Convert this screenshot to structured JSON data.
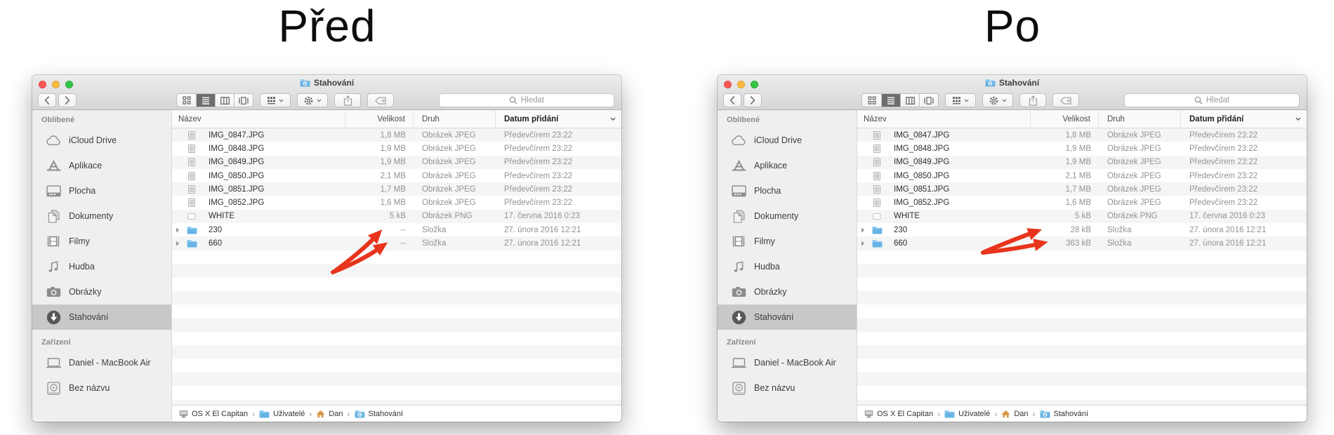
{
  "headings": {
    "left": "Před",
    "right": "Po"
  },
  "colors": {
    "arrow_red": "#e8341c",
    "folder_blue": "#68b3e5",
    "sidebar_selected_bg": "#c8c8c8",
    "traffic_red": "#fc5753",
    "traffic_yellow": "#fdbc40",
    "traffic_green": "#33c748"
  },
  "windows": {
    "left": {
      "title": "Stahování",
      "search_placeholder": "Hledat",
      "sidebar": {
        "sections": [
          {
            "label": "Oblíbené",
            "items": [
              {
                "icon": "cloud",
                "label": "iCloud Drive",
                "selected": false
              },
              {
                "icon": "apps",
                "label": "Aplikace",
                "selected": false
              },
              {
                "icon": "desktop",
                "label": "Plocha",
                "selected": false
              },
              {
                "icon": "docs",
                "label": "Dokumenty",
                "selected": false
              },
              {
                "icon": "film",
                "label": "Filmy",
                "selected": false
              },
              {
                "icon": "music",
                "label": "Hudba",
                "selected": false
              },
              {
                "icon": "camera",
                "label": "Obrázky",
                "selected": false
              },
              {
                "icon": "download",
                "label": "Stahování",
                "selected": true
              }
            ]
          },
          {
            "label": "Zařízení",
            "items": [
              {
                "icon": "laptop",
                "label": "Daniel - MacBook Air",
                "selected": false
              },
              {
                "icon": "disk",
                "label": "Bez názvu",
                "selected": false
              }
            ]
          }
        ]
      },
      "columns": {
        "name": "Název",
        "size": "Velikost",
        "kind": "Druh",
        "date": "Datum přidání"
      },
      "files": [
        {
          "icon": "jpeg",
          "name": "IMG_0847.JPG",
          "size": "1,8 MB",
          "kind": "Obrázek JPEG",
          "date": "Předevčírem 23:22"
        },
        {
          "icon": "jpeg",
          "name": "IMG_0848.JPG",
          "size": "1,9 MB",
          "kind": "Obrázek JPEG",
          "date": "Předevčírem 23:22"
        },
        {
          "icon": "jpeg",
          "name": "IMG_0849.JPG",
          "size": "1,9 MB",
          "kind": "Obrázek JPEG",
          "date": "Předevčírem 23:22"
        },
        {
          "icon": "jpeg",
          "name": "IMG_0850.JPG",
          "size": "2,1 MB",
          "kind": "Obrázek JPEG",
          "date": "Předevčírem 23:22"
        },
        {
          "icon": "jpeg",
          "name": "IMG_0851.JPG",
          "size": "1,7 MB",
          "kind": "Obrázek JPEG",
          "date": "Předevčírem 23:22"
        },
        {
          "icon": "jpeg",
          "name": "IMG_0852.JPG",
          "size": "1,6 MB",
          "kind": "Obrázek JPEG",
          "date": "Předevčírem 23:22"
        },
        {
          "icon": "png",
          "name": "WHITE",
          "size": "5 kB",
          "kind": "Obrázek PNG",
          "date": "17. června 2016 0:23"
        },
        {
          "icon": "folder",
          "name": "230",
          "size": "--",
          "kind": "Složka",
          "date": "27. února 2016 12:21"
        },
        {
          "icon": "folder",
          "name": "660",
          "size": "--",
          "kind": "Složka",
          "date": "27. února 2016 12:21"
        }
      ],
      "pathbar": [
        {
          "icon": "computer",
          "label": "OS X El Capitan"
        },
        {
          "icon": "folder",
          "label": "Uživatelé"
        },
        {
          "icon": "home",
          "label": "Dan"
        },
        {
          "icon": "folder-dl",
          "label": "Stahování"
        }
      ]
    },
    "right": {
      "title": "Stahování",
      "search_placeholder": "Hledat",
      "sidebar": {
        "sections": [
          {
            "label": "Oblíbené",
            "items": [
              {
                "icon": "cloud",
                "label": "iCloud Drive",
                "selected": false
              },
              {
                "icon": "apps",
                "label": "Aplikace",
                "selected": false
              },
              {
                "icon": "desktop",
                "label": "Plocha",
                "selected": false
              },
              {
                "icon": "docs",
                "label": "Dokumenty",
                "selected": false
              },
              {
                "icon": "film",
                "label": "Filmy",
                "selected": false
              },
              {
                "icon": "music",
                "label": "Hudba",
                "selected": false
              },
              {
                "icon": "camera",
                "label": "Obrázky",
                "selected": false
              },
              {
                "icon": "download",
                "label": "Stahování",
                "selected": true
              }
            ]
          },
          {
            "label": "Zařízení",
            "items": [
              {
                "icon": "laptop",
                "label": "Daniel - MacBook Air",
                "selected": false
              },
              {
                "icon": "disk",
                "label": "Bez názvu",
                "selected": false
              }
            ]
          }
        ]
      },
      "columns": {
        "name": "Název",
        "size": "Velikost",
        "kind": "Druh",
        "date": "Datum přidání"
      },
      "files": [
        {
          "icon": "jpeg",
          "name": "IMG_0847.JPG",
          "size": "1,8 MB",
          "kind": "Obrázek JPEG",
          "date": "Předevčírem 23:22"
        },
        {
          "icon": "jpeg",
          "name": "IMG_0848.JPG",
          "size": "1,9 MB",
          "kind": "Obrázek JPEG",
          "date": "Předevčírem 23:22"
        },
        {
          "icon": "jpeg",
          "name": "IMG_0849.JPG",
          "size": "1,9 MB",
          "kind": "Obrázek JPEG",
          "date": "Předevčírem 23:22"
        },
        {
          "icon": "jpeg",
          "name": "IMG_0850.JPG",
          "size": "2,1 MB",
          "kind": "Obrázek JPEG",
          "date": "Předevčírem 23:22"
        },
        {
          "icon": "jpeg",
          "name": "IMG_0851.JPG",
          "size": "1,7 MB",
          "kind": "Obrázek JPEG",
          "date": "Předevčírem 23:22"
        },
        {
          "icon": "jpeg",
          "name": "IMG_0852.JPG",
          "size": "1,6 MB",
          "kind": "Obrázek JPEG",
          "date": "Předevčírem 23:22"
        },
        {
          "icon": "png",
          "name": "WHITE",
          "size": "5 kB",
          "kind": "Obrázek PNG",
          "date": "17. června 2016 0:23"
        },
        {
          "icon": "folder",
          "name": "230",
          "size": "28 kB",
          "kind": "Složka",
          "date": "27. února 2016 12:21"
        },
        {
          "icon": "folder",
          "name": "660",
          "size": "363 kB",
          "kind": "Složka",
          "date": "27. února 2016 12:21"
        }
      ],
      "pathbar": [
        {
          "icon": "computer",
          "label": "OS X El Capitan"
        },
        {
          "icon": "folder",
          "label": "Uživatelé"
        },
        {
          "icon": "home",
          "label": "Dan"
        },
        {
          "icon": "folder-dl",
          "label": "Stahování"
        }
      ]
    }
  }
}
